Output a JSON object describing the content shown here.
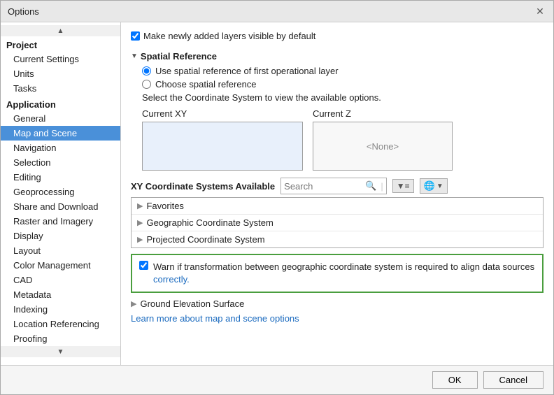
{
  "dialog": {
    "title": "Options",
    "close_label": "✕"
  },
  "sidebar": {
    "groups": [
      {
        "label": "Project",
        "items": [
          "Current Settings",
          "Units",
          "Tasks"
        ]
      },
      {
        "label": "Application",
        "items": [
          "General",
          "Map and Scene",
          "Navigation",
          "Selection",
          "Editing",
          "Geoprocessing",
          "Share and Download",
          "Raster and Imagery",
          "Display",
          "Layout",
          "Color Management",
          "CAD",
          "Metadata",
          "Indexing",
          "Location Referencing",
          "Proofing"
        ]
      }
    ],
    "active_item": "Map and Scene"
  },
  "content": {
    "top_checkbox_label": "Make newly added layers visible by default",
    "spatial_reference_header": "Spatial Reference",
    "radio1_label": "Use spatial reference of first operational layer",
    "radio2_label": "Choose spatial reference",
    "radio2_desc": "Select the Coordinate System to view the available options.",
    "current_xy_label": "Current XY",
    "current_z_label": "Current Z",
    "current_z_placeholder": "<None>",
    "xy_systems_label": "XY Coordinate Systems Available",
    "search_placeholder": "Search",
    "tree_items": [
      "Favorites",
      "Geographic Coordinate System",
      "Projected Coordinate System"
    ],
    "warn_checkbox_label": "Warn if transformation between geographic coordinate system is required to align data sources correctly.",
    "warn_blue_text": "correctly.",
    "ground_elevation_label": "Ground Elevation Surface",
    "learn_link": "Learn more about map and scene options"
  },
  "footer": {
    "ok_label": "OK",
    "cancel_label": "Cancel"
  }
}
